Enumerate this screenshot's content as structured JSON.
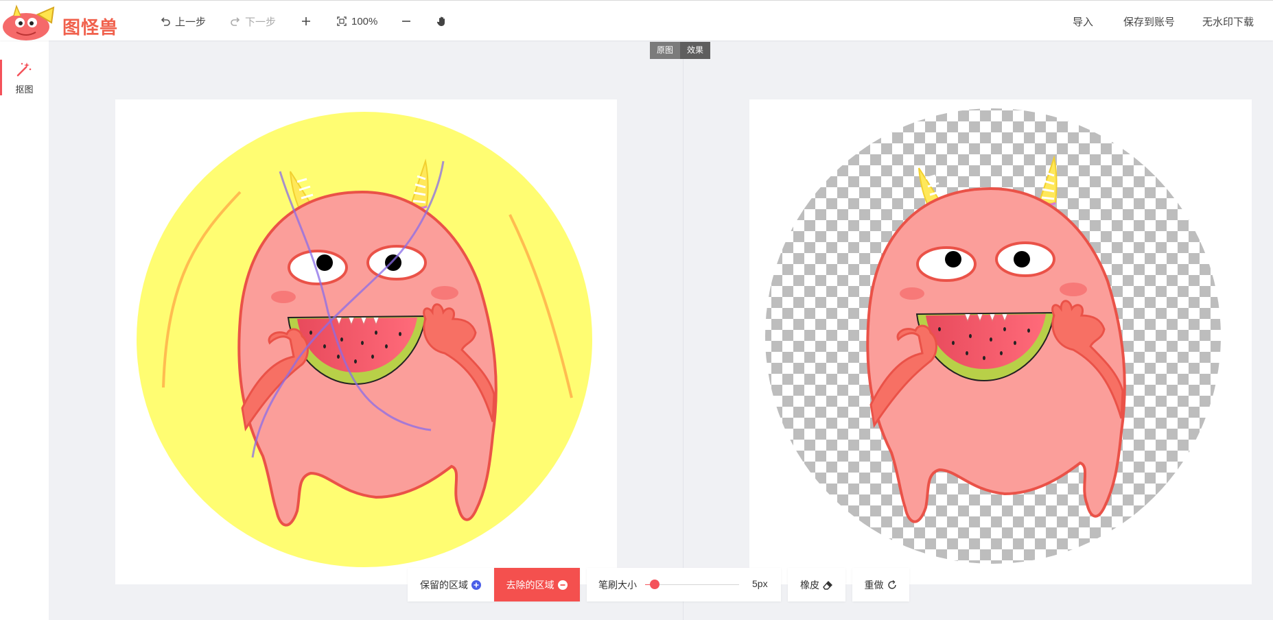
{
  "header": {
    "logo_text": "图怪兽",
    "undo_label": "上一步",
    "redo_label": "下一步",
    "zoom_value": "100%",
    "import_label": "导入",
    "save_label": "保存到账号",
    "download_label": "无水印下载"
  },
  "sidebar": {
    "items": [
      {
        "label": "抠图",
        "icon": "magic-wand-icon"
      }
    ]
  },
  "compare": {
    "original": "原图",
    "effect": "效果",
    "active": "effect"
  },
  "toolbar": {
    "keep_label": "保留的区域",
    "remove_label": "去除的区域",
    "brush_label": "笔刷大小",
    "brush_value": "5px",
    "brush_level": 0.1,
    "eraser_label": "橡皮",
    "redo_label": "重做"
  },
  "colors": {
    "accent": "#f4525a",
    "remove_bg": "#f4504e",
    "keep_plus": "#4a5de8"
  }
}
